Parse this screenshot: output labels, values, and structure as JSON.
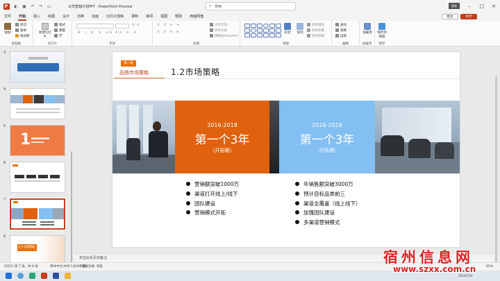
{
  "titlebar": {
    "doc_title": "公司营销计划PPT  ·  PowerPoint Preview",
    "search_placeholder": "搜索",
    "user_label": "登录"
  },
  "tabs": [
    "文件",
    "开始",
    "插入",
    "绘图",
    "设计",
    "切换",
    "动画",
    "幻灯片放映",
    "录制",
    "审阅",
    "视图",
    "帮助",
    "西面网盘"
  ],
  "active_tab_index": 1,
  "share_labels": {
    "comment": "批注",
    "share": "共享"
  },
  "ribbon": {
    "groups": [
      {
        "label": "剪贴板"
      },
      {
        "label": "幻灯片"
      },
      {
        "label": "字体"
      },
      {
        "label": "段落"
      },
      {
        "label": "绘图"
      },
      {
        "label": "编辑"
      },
      {
        "label": "加载项"
      },
      {
        "label": "保存"
      }
    ],
    "paste": "粘贴",
    "cut": "剪切",
    "copy": "复制",
    "format_painter": "格式刷",
    "new_slide": "新建幻灯片",
    "layout": "版式",
    "reset": "重置",
    "section": "节",
    "font_name": "",
    "font_size": "",
    "text_direction": "文字方向",
    "align_text": "对齐文本",
    "convert_smartart": "转换为SmartArt",
    "shape_btn": "形状",
    "arrange": "排列",
    "quick_styles": "快速样式",
    "shape_fill": "形状填充",
    "shape_outline": "形状轮廓",
    "shape_effects": "形状效果",
    "find": "查找",
    "replace": "替换",
    "select": "选择",
    "addins": "加载项",
    "save_to_cloud": "保存到网盘"
  },
  "thumbnails": [
    {
      "num": "3"
    },
    {
      "num": "4"
    },
    {
      "num": "5",
      "big_text": "1"
    },
    {
      "num": "6"
    },
    {
      "num": "7"
    },
    {
      "num": "8",
      "text": "五个品牌策略"
    }
  ],
  "selected_thumbnail": 4,
  "slide": {
    "chapter_badge": "第一章",
    "chapter_sub": "品牌市场策略",
    "title": "1.2市场策略",
    "left_panel": {
      "years": "2016-2018",
      "big": "第一个3年",
      "sub": "（开拓期）",
      "color": "#e0620f"
    },
    "right_panel": {
      "years": "2016-2018",
      "big": "第一个3年",
      "sub": "（开拓期）",
      "color": "#83bff2"
    },
    "left_bullets": [
      "营销额突破1000万",
      "渠道打开线上/线下",
      "团队建设",
      "营销模式开拓"
    ],
    "right_bullets": [
      "年销售额突破3000万",
      "预计目标品类前三",
      "渠道全覆盖（线上线下）",
      "加强团队建设",
      "多渠道营销模式"
    ]
  },
  "notes_placeholder": "单击此处添加备注",
  "status": {
    "slide_info": "幻灯片 第 7 张，共 8 张",
    "language": "简体中文(中华人民共和国)",
    "accessibility": "辅助功能: 调查",
    "zoom": "85%"
  },
  "taskbar": {
    "date": "2024/7/14"
  },
  "watermark": {
    "line1": "宿州信息网",
    "line2": "www.szxx.com.cn"
  }
}
